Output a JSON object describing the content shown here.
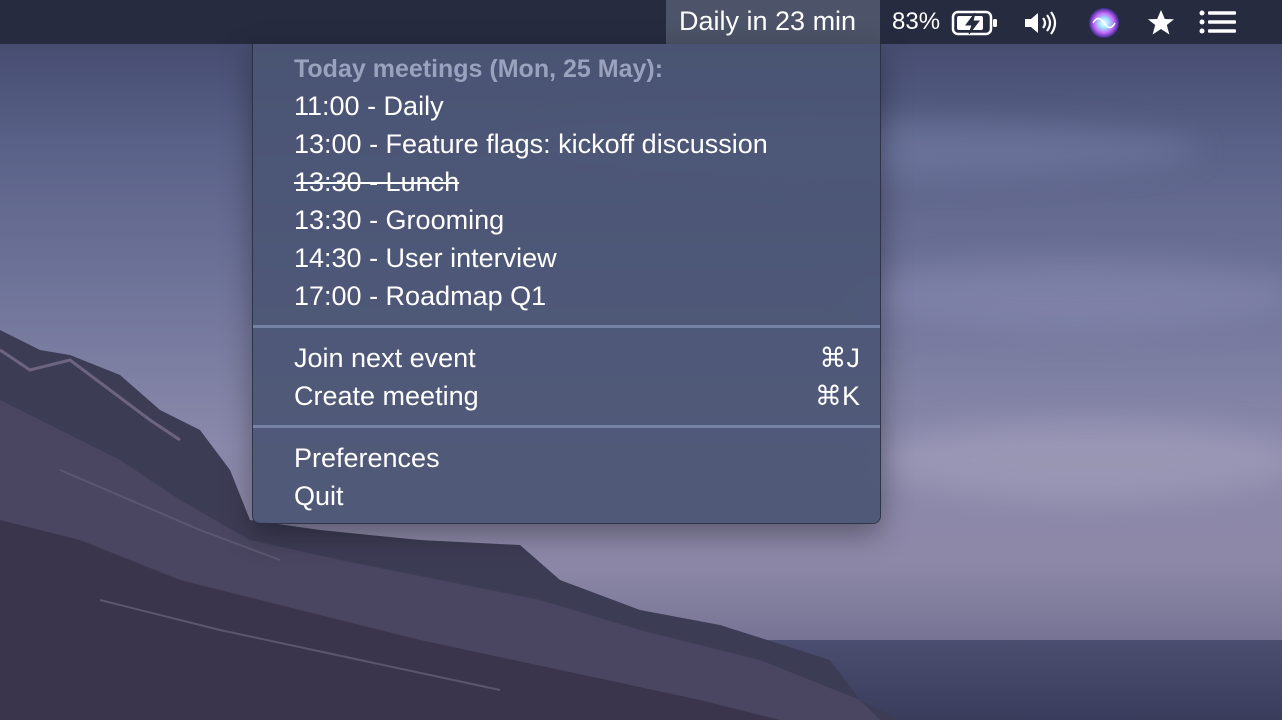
{
  "menubar": {
    "status_title": "Daily in 23 min",
    "battery_percent": "83%",
    "icons": [
      "battery-charging-icon",
      "volume-icon",
      "siri-icon",
      "star-icon",
      "notification-center-icon"
    ]
  },
  "menu": {
    "header": "Today meetings (Mon, 25 May):",
    "events": [
      {
        "label": "11:00 - Daily",
        "past": false
      },
      {
        "label": "13:00 - Feature flags: kickoff discussion",
        "past": false
      },
      {
        "label": "13:30 - Lunch",
        "past": true
      },
      {
        "label": "13:30 - Grooming",
        "past": false
      },
      {
        "label": "14:30 - User interview",
        "past": false
      },
      {
        "label": "17:00 - Roadmap Q1",
        "past": false
      }
    ],
    "actions": [
      {
        "label": "Join next event",
        "shortcut": "⌘J"
      },
      {
        "label": "Create meeting",
        "shortcut": "⌘K"
      }
    ],
    "preferences_label": "Preferences",
    "quit_label": "Quit"
  },
  "colors": {
    "menubar_bg": "#262b40",
    "menu_bg": "#4a5473",
    "header_text": "#9aa3bd"
  }
}
